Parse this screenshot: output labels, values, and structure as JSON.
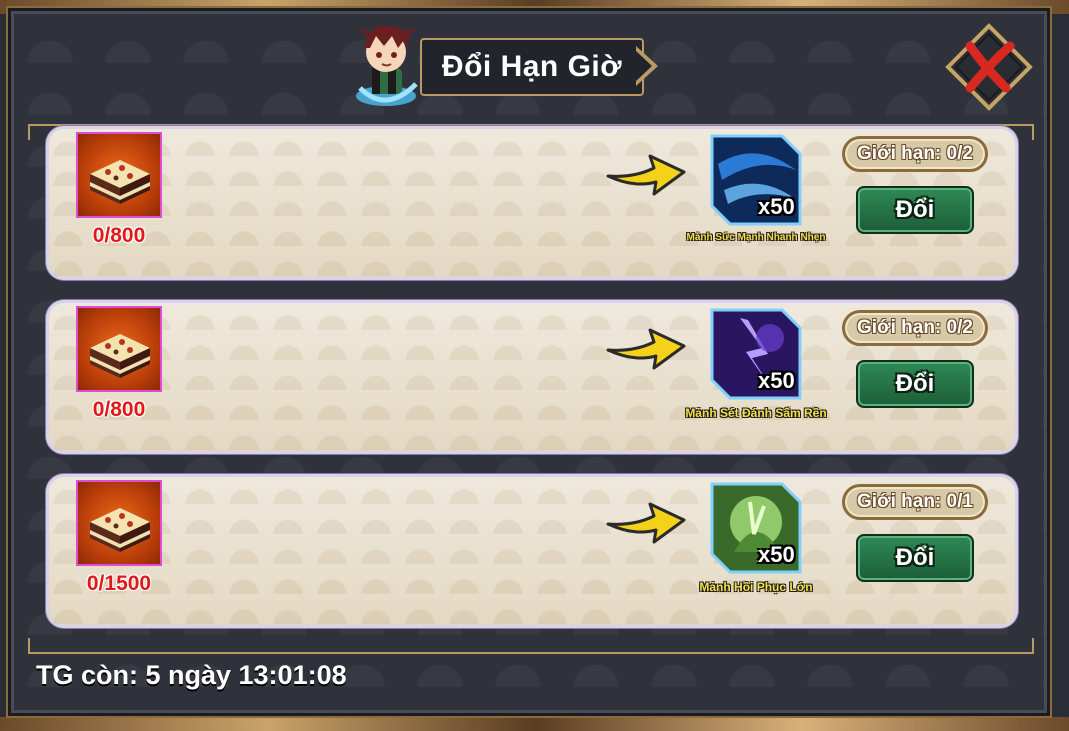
{
  "window": {
    "title": "Đổi Hạn Giờ"
  },
  "rows": [
    {
      "cost_count": "0/800",
      "reward_qty": "x50",
      "reward_name": "Mảnh Sức Mạnh Nhanh Nhẹn",
      "limit": "Giới hạn: 0/2",
      "button": "Đổi",
      "reward_color": "#2a7bd6"
    },
    {
      "cost_count": "0/800",
      "reward_qty": "x50",
      "reward_name": "Mảnh Sét Đánh Sấm Rền",
      "limit": "Giới hạn: 0/2",
      "button": "Đổi",
      "reward_color": "#6a3fd0"
    },
    {
      "cost_count": "0/1500",
      "reward_qty": "x50",
      "reward_name": "Mảnh Hồi Phục Lớn",
      "limit": "Giới hạn: 0/1",
      "button": "Đổi",
      "reward_color": "#7bbf4a"
    }
  ],
  "timer": "TG còn: 5 ngày 13:01:08",
  "colors": {
    "count_red": "#e01818",
    "button_green": "#2f8a55",
    "gold_border": "#b99a63"
  },
  "icons": {
    "cost_item": "cake-item-icon",
    "arrow": "yellow-arrow-icon",
    "close": "close-x-icon",
    "avatar": "character-avatar-icon"
  }
}
